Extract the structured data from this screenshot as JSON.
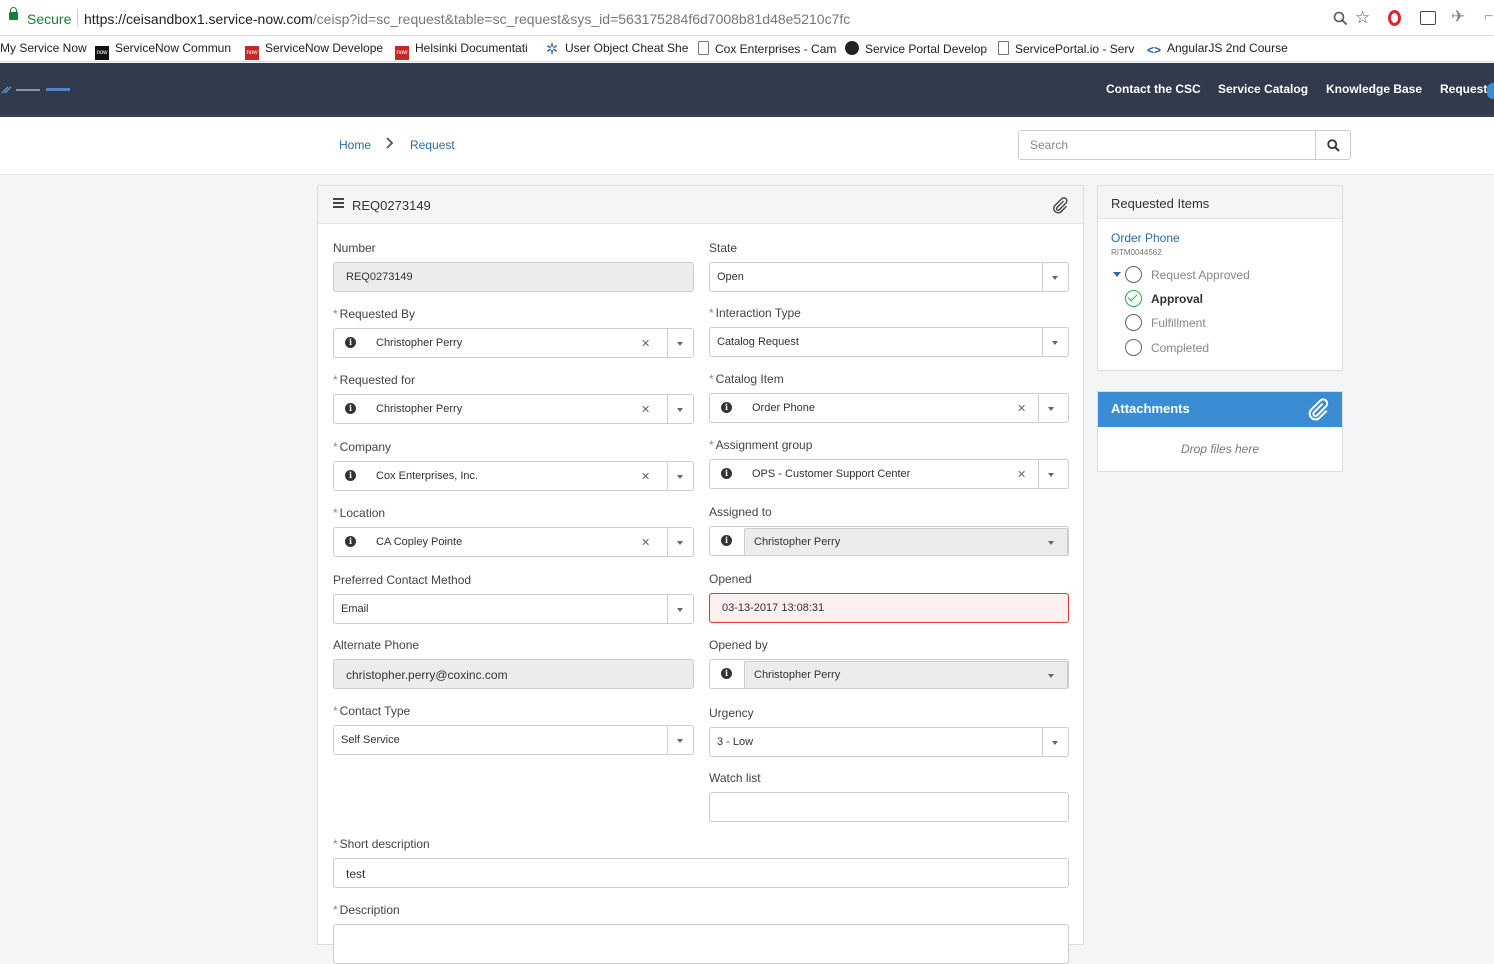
{
  "browser": {
    "secure_label": "Secure",
    "url_host": "https://ceisandbox1.service-now.com",
    "url_rest": "/ceisp?id=sc_request&table=sc_request&sys_id=563175284f6d7008b81d48e5210c7fc"
  },
  "bookmarks": [
    {
      "label": "My Service Now",
      "icon": "none"
    },
    {
      "label": "ServiceNow Commun",
      "icon": "now-logo-icon"
    },
    {
      "label": "ServiceNow Develope",
      "icon": "now-red-icon"
    },
    {
      "label": "Helsinki Documentati",
      "icon": "now-red-icon"
    },
    {
      "label": "User Object Cheat She",
      "icon": "gear-icon"
    },
    {
      "label": "Cox Enterprises - Cam",
      "icon": "page-icon"
    },
    {
      "label": "Service Portal Develop",
      "icon": "github-icon"
    },
    {
      "label": "ServicePortal.io - Serv",
      "icon": "page-icon"
    },
    {
      "label": "AngularJS 2nd Course",
      "icon": "angular-icon"
    }
  ],
  "nav": {
    "links": [
      "Contact the CSC",
      "Service Catalog",
      "Knowledge Base",
      "Requests"
    ]
  },
  "breadcrumb": {
    "home": "Home",
    "current": "Request"
  },
  "search": {
    "placeholder": "Search"
  },
  "form": {
    "title": "REQ0273149",
    "number": {
      "label": "Number",
      "value": "REQ0273149"
    },
    "state": {
      "label": "State",
      "value": "Open"
    },
    "requested_by": {
      "label": "Requested By",
      "value": "Christopher Perry"
    },
    "interaction_type": {
      "label": "Interaction Type",
      "value": "Catalog Request"
    },
    "requested_for": {
      "label": "Requested for",
      "value": "Christopher Perry"
    },
    "catalog_item": {
      "label": "Catalog Item",
      "value": "Order Phone"
    },
    "company": {
      "label": "Company",
      "value": "Cox Enterprises, Inc."
    },
    "assignment_group": {
      "label": "Assignment group",
      "value": "OPS - Customer Support Center"
    },
    "location": {
      "label": "Location",
      "value": "CA Copley Pointe"
    },
    "assigned_to": {
      "label": "Assigned to",
      "value": "Christopher Perry"
    },
    "preferred_contact": {
      "label": "Preferred Contact Method",
      "value": "Email"
    },
    "opened": {
      "label": "Opened",
      "value": "03-13-2017 13:08:31"
    },
    "alternate_phone": {
      "label": "Alternate Phone",
      "value": "christopher.perry@coxinc.com"
    },
    "opened_by": {
      "label": "Opened by",
      "value": "Christopher Perry"
    },
    "contact_type": {
      "label": "Contact Type",
      "value": "Self Service"
    },
    "urgency": {
      "label": "Urgency",
      "value": "3 - Low"
    },
    "watch_list": {
      "label": "Watch list",
      "value": ""
    },
    "short_description": {
      "label": "Short description",
      "value": "test"
    },
    "description": {
      "label": "Description"
    },
    "required_marker": "*"
  },
  "requested_items": {
    "title": "Requested Items",
    "item_name": "Order Phone",
    "item_number": "RITM0044562",
    "stages": [
      {
        "label": "Request Approved",
        "status": "pending"
      },
      {
        "label": "Approval",
        "status": "complete"
      },
      {
        "label": "Fulfillment",
        "status": "pending"
      },
      {
        "label": "Completed",
        "status": "pending"
      }
    ]
  },
  "attachments": {
    "title": "Attachments",
    "drop_text": "Drop files here"
  },
  "colors": {
    "header_bg": "#323a4d",
    "link": "#2d6ca2",
    "accent_blue": "#3b8dd3",
    "success": "#2fa84f",
    "error": "#d83a3a"
  }
}
